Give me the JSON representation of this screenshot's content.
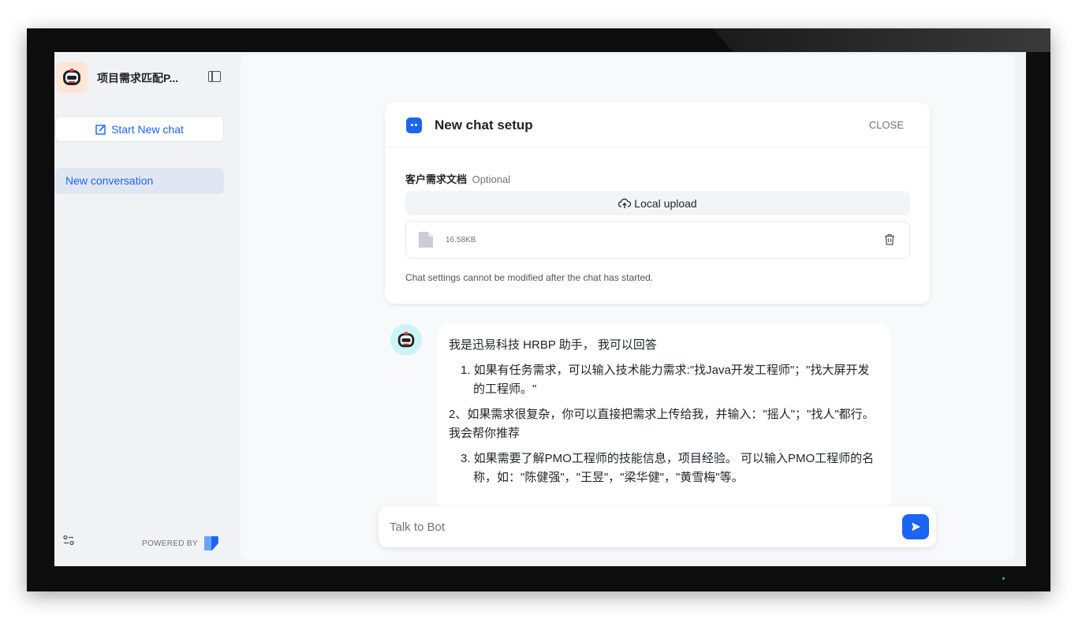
{
  "sidebar": {
    "app_name": "项目需求匹配P...",
    "new_chat_label": "Start New chat",
    "conversations": [
      {
        "label": "New conversation",
        "active": true
      }
    ],
    "powered_by": "POWERED BY"
  },
  "setup": {
    "title": "New chat setup",
    "close_label": "CLOSE",
    "field_label": "客户需求文档",
    "field_optional": "Optional",
    "upload_label": "Local upload",
    "file": {
      "size": "16.58KB"
    },
    "note": "Chat settings cannot be modified after the chat has started."
  },
  "message": {
    "intro": "我是迅易科技 HRBP 助手， 我可以回答",
    "item1": "1. 如果有任务需求，可以输入技术能力需求:\"找Java开发工程师\"；\"找大屏开发的工程师。\"",
    "item2": "2、如果需求很复杂，你可以直接把需求上传给我，并输入：\"摇人\"；\"找人\"都行。 我会帮你推荐",
    "item3": "3. 如果需要了解PMO工程师的技能信息，项目经验。 可以输入PMO工程师的名称，如：\"陈健强\"，\"王昱\"，\"梁华健\"，\"黄雪梅\"等。"
  },
  "input": {
    "placeholder": "Talk to Bot"
  },
  "colors": {
    "accent": "#1c64f2",
    "sidebar_bg": "#f1f2f6",
    "active_item_bg": "#e1e6f3"
  }
}
